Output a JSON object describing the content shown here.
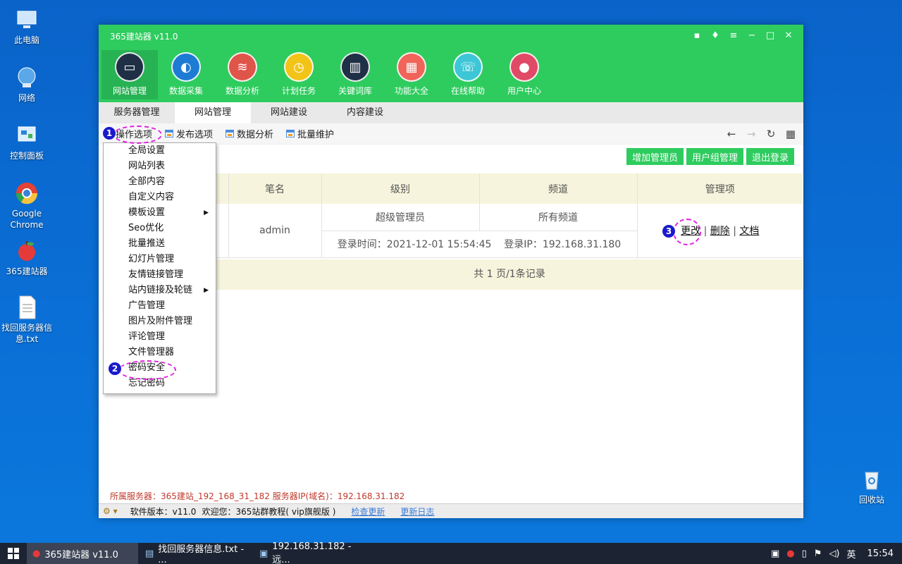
{
  "desktop": {
    "icons": [
      {
        "label": "此电脑"
      },
      {
        "label": "网络"
      },
      {
        "label": "控制面板"
      },
      {
        "label": "Google Chrome"
      },
      {
        "label": "365建站器"
      },
      {
        "label": "找回服务器信息.txt"
      },
      {
        "label": "回收站"
      }
    ]
  },
  "window": {
    "title": "365建站器 v11.0",
    "controls": [
      "chat-icon",
      "shirt-icon",
      "menu-icon",
      "minimize-icon",
      "maximize-icon",
      "close-icon"
    ]
  },
  "modules": [
    {
      "label": "网站管理",
      "color": "#1f2f46",
      "icon": "monitor-icon"
    },
    {
      "label": "数据采集",
      "color": "#1d7bd3",
      "icon": "edge-icon"
    },
    {
      "label": "数据分析",
      "color": "#e0554a",
      "icon": "database-icon"
    },
    {
      "label": "计划任务",
      "color": "#f2c418",
      "icon": "clock-icon"
    },
    {
      "label": "关键词库",
      "color": "#1f2f46",
      "icon": "book-icon"
    },
    {
      "label": "功能大全",
      "color": "#f0645a",
      "icon": "grid-icon"
    },
    {
      "label": "在线帮助",
      "color": "#3cc6d6",
      "icon": "headset-icon"
    },
    {
      "label": "用户中心",
      "color": "#e04a66",
      "icon": "user-icon"
    }
  ],
  "tabs": [
    "服务器管理",
    "网站管理",
    "网站建设",
    "内容建设"
  ],
  "toolbar": {
    "items": [
      "操作选项",
      "发布选项",
      "数据分析",
      "批量维护"
    ]
  },
  "actions": [
    "增加管理员",
    "用户组管理",
    "退出登录"
  ],
  "table": {
    "headers": [
      "",
      "笔名",
      "级别",
      "频道",
      "管理项"
    ],
    "row": {
      "name": "admin",
      "level": "超级管理员",
      "channel": "所有频道",
      "login_time": "登录时间：2021-12-01 15:54:45",
      "login_ip": "登录IP：192.168.31.180",
      "ops": [
        "更改",
        "删除",
        "文档"
      ],
      "separator": "|"
    },
    "footer": "共 1 页/1条记录"
  },
  "menu": {
    "items": [
      "全局设置",
      "网站列表",
      "全部内容",
      "自定义内容",
      "模板设置",
      "Seo优化",
      "批量推送",
      "幻灯片管理",
      "友情链接管理",
      "站内链接及轮链",
      "广告管理",
      "图片及附件管理",
      "评论管理",
      "文件管理器",
      "密码安全",
      "忘记密码"
    ]
  },
  "markers": [
    "1",
    "2",
    "3"
  ],
  "status": {
    "server": "所属服务器：365建站_192_168_31_182 服务器IP(域名)：192.168.31.182"
  },
  "bottom": {
    "version": "软件版本：v11.0",
    "welcome": "欢迎您：365站群教程( vip旗舰版 )",
    "check_update": "检查更新",
    "update_log": "更新日志"
  },
  "taskbar": {
    "tasks": [
      "365建站器 v11.0",
      "找回服务器信息.txt - ...",
      "192.168.31.182 - 远..."
    ],
    "lang": "英",
    "time": "15:54"
  }
}
